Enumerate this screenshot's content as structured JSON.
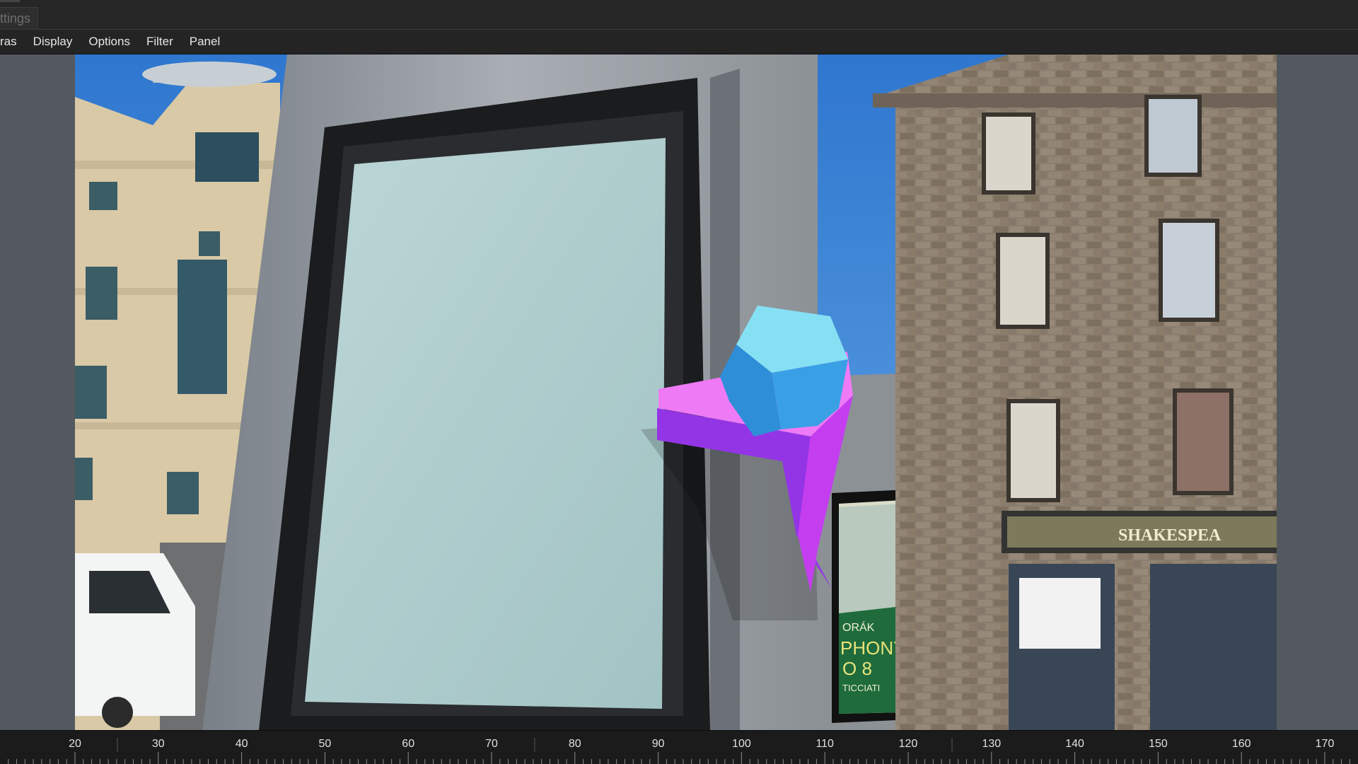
{
  "app": {
    "tab_label": "ttings"
  },
  "menu": {
    "items": [
      "ras",
      "Display",
      "Options",
      "Filter",
      "Panel"
    ]
  },
  "viewer": {
    "scene_sign_text": "SHAKESPEA",
    "poster_lines": [
      "ORÁK",
      "PHONY",
      "O 8",
      "TICCIATI"
    ],
    "colors": {
      "sky": "#3f86d6",
      "cube_top": "#86e0f4",
      "cube_side": "#2f8ed8",
      "shelf_top": "#ef7af5",
      "shelf_front": "#9435e5",
      "shelf_side": "#c43ef0"
    }
  },
  "timeline": {
    "ticks": [
      20,
      30,
      40,
      50,
      60,
      70,
      80,
      90,
      100,
      110,
      120,
      130,
      140,
      150,
      160,
      170
    ]
  }
}
